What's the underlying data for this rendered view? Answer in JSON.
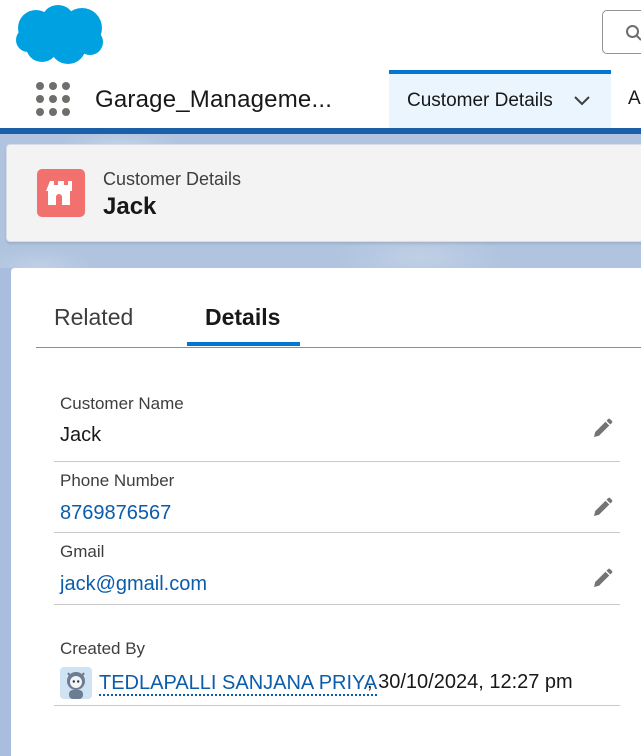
{
  "header": {
    "logo": "salesforce-cloud-logo",
    "search_icon": "search-icon"
  },
  "app_nav": {
    "app_name": "Garage_Manageme...",
    "active_tab_label": "Customer Details",
    "next_tab_label": "A"
  },
  "record": {
    "object_label": "Customer Details",
    "title": "Jack",
    "object_icon": "castle-icon",
    "object_icon_color": "#f2706e"
  },
  "tabs": {
    "related": "Related",
    "details": "Details"
  },
  "fields": {
    "customer_name": {
      "label": "Customer Name",
      "value": "Jack"
    },
    "phone_number": {
      "label": "Phone Number",
      "value": "8769876567"
    },
    "gmail": {
      "label": "Gmail",
      "value": "jack@gmail.com"
    },
    "created_by": {
      "label": "Created By",
      "user": "TEDLAPALLI SANJANA PRIYA",
      "date": ", 30/10/2024, 12:27 pm"
    }
  },
  "colors": {
    "brand_blue": "#0176d3",
    "link": "#0b5cab",
    "background_band": "#b0c4df"
  }
}
